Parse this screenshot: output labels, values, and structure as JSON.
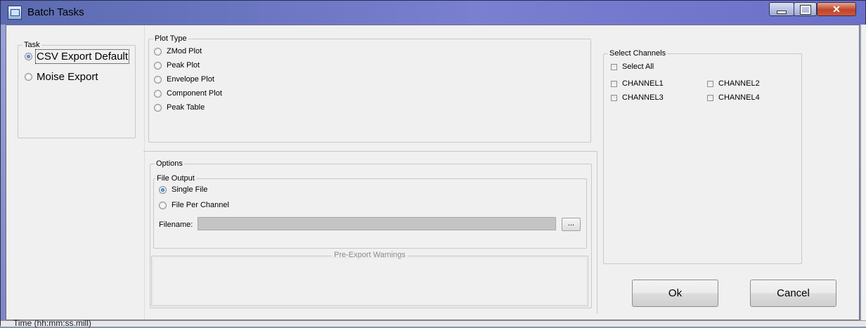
{
  "window": {
    "title": "Batch Tasks",
    "close_glyph": "✕"
  },
  "task": {
    "legend": "Task",
    "options": [
      {
        "label": "CSV Export Default",
        "selected": true
      },
      {
        "label": "Moise Export",
        "selected": false
      }
    ]
  },
  "plot_type": {
    "legend": "Plot Type",
    "options": [
      {
        "label": "ZMod Plot"
      },
      {
        "label": "Peak Plot"
      },
      {
        "label": "Envelope Plot"
      },
      {
        "label": "Component Plot"
      },
      {
        "label": "Peak Table"
      }
    ]
  },
  "options": {
    "legend": "Options",
    "file_output": {
      "legend": "File Output",
      "single_file": "Single File",
      "file_per_channel": "File Per Channel",
      "selected": "Single File"
    },
    "filename_label": "Filename:",
    "filename_value": "",
    "browse_label": "...",
    "warnings_title": "Pre-Export Warnings"
  },
  "channels": {
    "legend": "Select Channels",
    "select_all": "Select All",
    "items": [
      "CHANNEL1",
      "CHANNEL2",
      "CHANNEL3",
      "CHANNEL4"
    ]
  },
  "buttons": {
    "ok": "Ok",
    "cancel": "Cancel"
  },
  "background": {
    "status_text": "Time (hh:mm:ss.mill)"
  }
}
